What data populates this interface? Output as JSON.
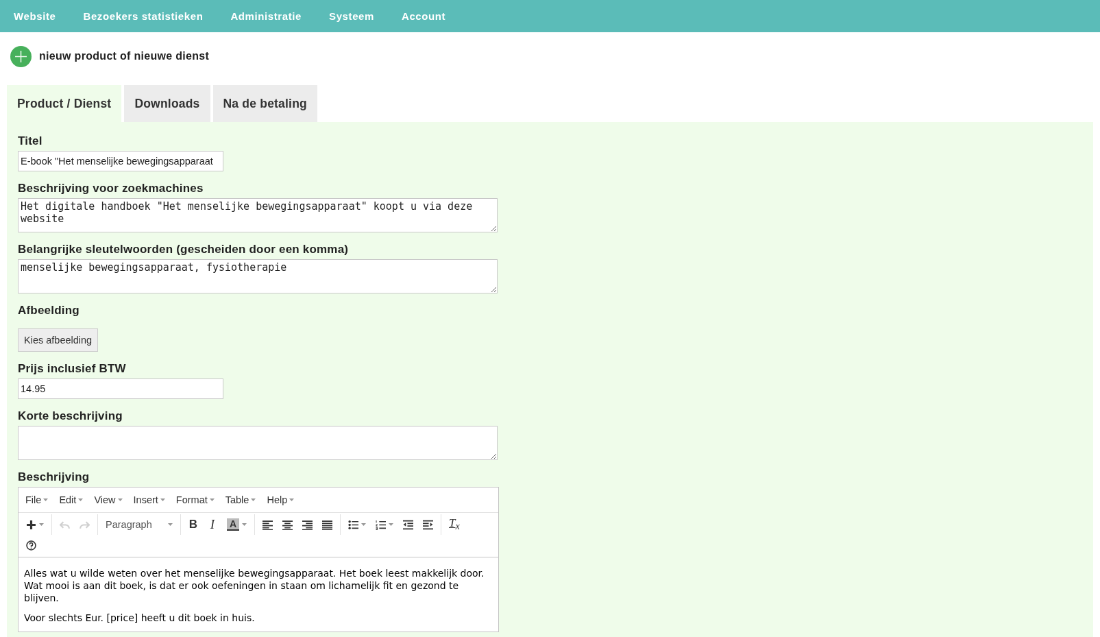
{
  "nav": [
    {
      "label": "Website"
    },
    {
      "label": "Bezoekers statistieken"
    },
    {
      "label": "Administratie"
    },
    {
      "label": "Systeem"
    },
    {
      "label": "Account"
    }
  ],
  "new_item": {
    "label": "nieuw product of nieuwe dienst"
  },
  "tabs": [
    {
      "label": "Product / Dienst",
      "selected": true
    },
    {
      "label": "Downloads",
      "selected": false
    },
    {
      "label": "Na de betaling",
      "selected": false
    }
  ],
  "fields": [
    {
      "kind": "input",
      "label": "Titel",
      "value": "E-book \"Het menselijke bewegingsapparaat"
    },
    {
      "kind": "textarea",
      "label": "Beschrijving voor zoekmachines",
      "value": "Het digitale handboek \"Het menselijke bewegingsapparaat\" koopt u via deze website"
    },
    {
      "kind": "textarea",
      "label": "Belangrijke sleutelwoorden (gescheiden door een komma)",
      "value": "menselijke bewegingsapparaat, fysiotherapie"
    },
    {
      "kind": "button",
      "label": "Afbeelding",
      "button": "Kies afbeelding"
    },
    {
      "kind": "input",
      "label": "Prijs inclusief BTW",
      "value": "14.95"
    },
    {
      "kind": "textarea",
      "label": "Korte beschrijving"
    }
  ],
  "editor": {
    "label": "Beschrijving",
    "menus": [
      {
        "label": "File"
      },
      {
        "label": "Edit"
      },
      {
        "label": "View"
      },
      {
        "label": "Insert"
      },
      {
        "label": "Format"
      },
      {
        "label": "Table"
      },
      {
        "label": "Help"
      }
    ],
    "toolbar": {
      "undo_disabled": true,
      "redo_disabled": true,
      "format": "Paragraph",
      "bold": "B",
      "italic": "I",
      "text_color": "A",
      "clear_format": "T$_{x}$"
    },
    "paragraphs": [
      "Alles wat u wilde weten over het menselijke bewegingsapparaat. Het boek leest makkelijk door. Wat mooi is aan dit boek, is dat er ook oefeningen in staan om lichamelijk fit en gezond te blijven.",
      "Voor slechts Eur. [price] heeft u dit boek in huis."
    ]
  }
}
